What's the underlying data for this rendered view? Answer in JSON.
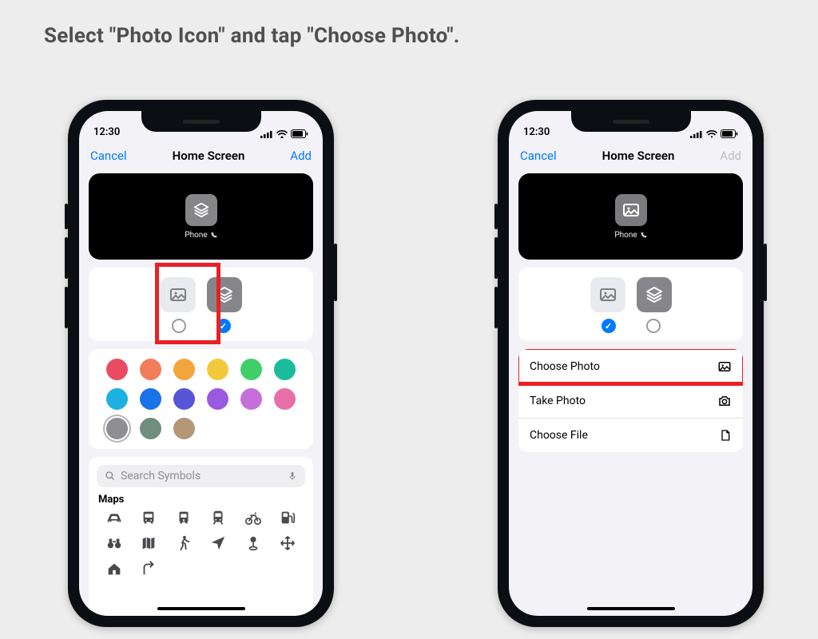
{
  "instruction": "Select \"Photo Icon\" and tap \"Choose Photo\".",
  "status": {
    "time": "12:30"
  },
  "nav": {
    "cancel": "Cancel",
    "title": "Home Screen",
    "add": "Add"
  },
  "preview": {
    "caption": "Phone"
  },
  "search": {
    "placeholder": "Search Symbols",
    "section": "Maps"
  },
  "palette": {
    "row1": [
      "#eb4b62",
      "#f17d5b",
      "#f3a43c",
      "#f3c93c",
      "#3fcf69",
      "#1abc9b"
    ],
    "row2": [
      "#1cb1e0",
      "#1a73e8",
      "#5856d6",
      "#9b59e0",
      "#c66fd9",
      "#e86fa8"
    ],
    "row3": [
      "#8e8e93",
      "#6f8e7d",
      "#b49777"
    ]
  },
  "actions": {
    "choose_photo": "Choose Photo",
    "take_photo": "Take Photo",
    "choose_file": "Choose File"
  }
}
